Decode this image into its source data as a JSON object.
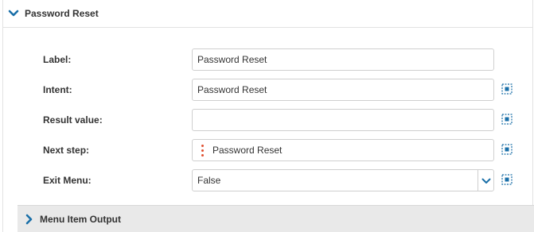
{
  "panel": {
    "title": "Password Reset",
    "icon": "chevron-down-icon",
    "expanded": true
  },
  "form": {
    "label": {
      "label": "Label:",
      "value": "Password Reset"
    },
    "intent": {
      "label": "Intent:",
      "value": "Password Reset"
    },
    "result_value": {
      "label": "Result value:",
      "value": ""
    },
    "next_step": {
      "label": "Next step:",
      "value": "Password Reset",
      "icon": "step-dots-icon"
    },
    "exit_menu": {
      "label": "Exit Menu:",
      "value": "False",
      "icon": "chevron-down-icon"
    }
  },
  "variable_icon": "variable-picker-icon",
  "section": {
    "title": "Menu Item Output",
    "icon": "chevron-right-icon",
    "expanded": false
  },
  "colors": {
    "accent": "#1a6fa8",
    "step_dots": "#e04e2f",
    "section_bg": "#e9e9e9",
    "border": "#cfcfcf"
  }
}
